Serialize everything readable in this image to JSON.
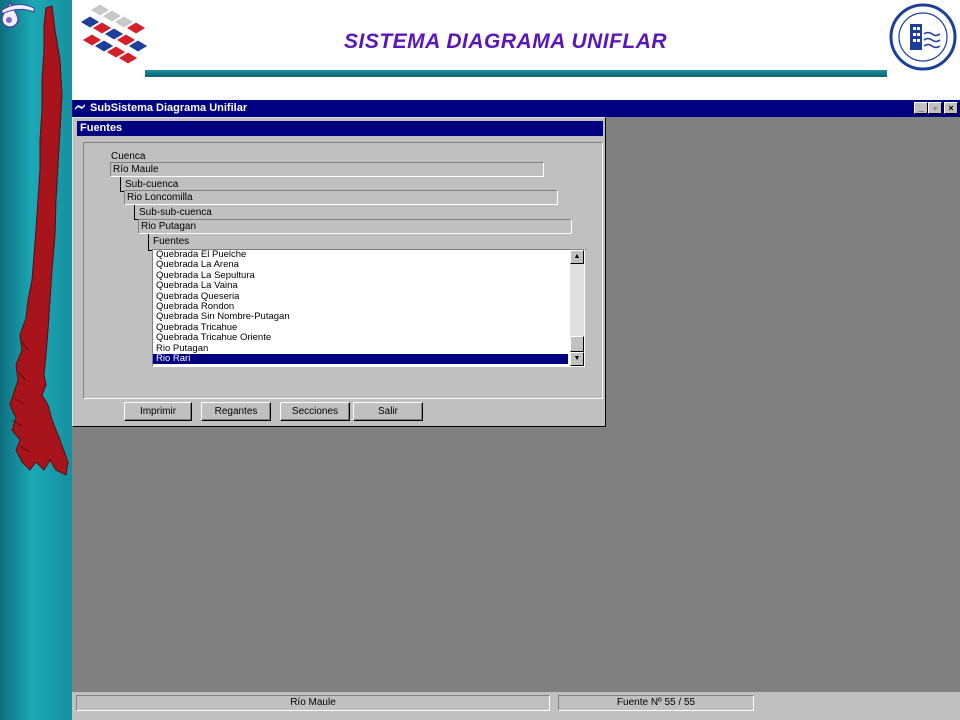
{
  "slide": {
    "title": "Sistema Diagrama Uniflar"
  },
  "app": {
    "title": "SubSistema Diagrama Unifilar",
    "controls": [
      "_",
      "▫",
      "×"
    ]
  },
  "dialog": {
    "title": "Fuentes",
    "cuenca": {
      "label": "Cuenca",
      "value": "Río Maule"
    },
    "subcuenca": {
      "label": "Sub-cuenca",
      "value": "Rio Loncomilla"
    },
    "subsubcuenca": {
      "label": "Sub-sub-cuenca",
      "value": "Rio Putagan"
    },
    "fuentes": {
      "label": "Fuentes",
      "items": [
        "Quebrada El Puelche",
        "Quebrada La Arena",
        "Quebrada La Sepultura",
        "Quebrada La Vaina",
        "Quebrada Queseria",
        "Quebrada Rondon",
        "Quebrada Sin Nombre-Putagan",
        "Quebrada Tricahue",
        "Quebrada Tricahue Oriente",
        "Rio Putagan",
        "Rio Rari"
      ],
      "selected_index": 10
    },
    "buttons": [
      "Imprimir",
      "Regantes",
      "Secciones",
      "Salir"
    ]
  },
  "status": {
    "cuenca": "Río Maule",
    "fuente": "Fuente Nº 55 / 55"
  },
  "colors": {
    "title": "#5a16b8",
    "teal": "#1ba8b6",
    "titlebar": "#000080",
    "map": "#a8141c"
  }
}
